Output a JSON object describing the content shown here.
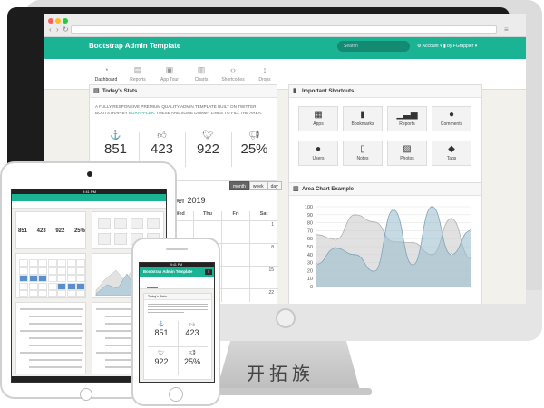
{
  "browser": {
    "title": "Bootstrap Admin Template",
    "search_placeholder": "Search",
    "account_label": "Account",
    "user_label": "by FGrappler"
  },
  "menu": [
    {
      "label": "Dashboard",
      "icon": "dashboard-icon",
      "active": true
    },
    {
      "label": "Reports",
      "icon": "reports-icon",
      "active": false
    },
    {
      "label": "App Tour",
      "icon": "tour-icon",
      "active": false
    },
    {
      "label": "Charts",
      "icon": "charts-icon",
      "active": false
    },
    {
      "label": "Shortcodes",
      "icon": "code-icon",
      "active": false
    },
    {
      "label": "Drops",
      "icon": "drops-icon",
      "active": false
    }
  ],
  "stats": {
    "title": "Today's Stats",
    "description_prefix": "A fully responsive premium quality admin template built on Twitter Bootstrap by",
    "description_link": "EGrappler",
    "description_suffix": ". These are some dummy lines to fill the area.",
    "items": [
      {
        "icon": "anchor-icon",
        "value": "851"
      },
      {
        "icon": "thumbs-up-icon",
        "value": "423"
      },
      {
        "icon": "twitter-icon",
        "value": "922"
      },
      {
        "icon": "bullhorn-icon",
        "value": "25%"
      }
    ]
  },
  "shortcuts": {
    "title": "Important Shortcuts",
    "items": [
      {
        "label": "Apps",
        "icon": "apps-icon"
      },
      {
        "label": "Bookmarks",
        "icon": "bookmark-icon"
      },
      {
        "label": "Reports",
        "icon": "signal-icon"
      },
      {
        "label": "Comments",
        "icon": "comment-icon"
      },
      {
        "label": "Users",
        "icon": "user-icon"
      },
      {
        "label": "Notes",
        "icon": "file-icon"
      },
      {
        "label": "Photos",
        "icon": "picture-icon"
      },
      {
        "label": "Tags",
        "icon": "tag-icon"
      }
    ]
  },
  "calendar": {
    "month_title": "ber 2019",
    "buttons": [
      "month",
      "week",
      "day"
    ],
    "headers": [
      "Wed",
      "Thu",
      "Fri",
      "Sat"
    ],
    "row1": [
      "",
      "",
      "",
      "1"
    ],
    "row2": [
      "",
      "",
      "",
      "8"
    ],
    "row3": [
      "",
      "",
      "",
      "15"
    ],
    "row4": [
      "",
      "",
      "",
      "22"
    ]
  },
  "chart": {
    "title": "Area Chart Example"
  },
  "chart_data": {
    "type": "area",
    "title": "Area Chart Example",
    "ylim": [
      0,
      100
    ],
    "yticks": [
      0,
      10,
      20,
      30,
      40,
      50,
      60,
      70,
      80,
      90,
      100
    ],
    "grid": true,
    "series": [
      {
        "values": [
          65,
          59,
          90,
          81,
          56,
          55,
          40,
          85,
          35
        ]
      },
      {
        "values": [
          28,
          48,
          40,
          19,
          96,
          27,
          100,
          40,
          70
        ]
      }
    ]
  },
  "tablet": {
    "status_time": "9:41 PM",
    "stats": [
      "851",
      "423",
      "922",
      "25%"
    ]
  },
  "phone": {
    "status_time": "9:41 PM",
    "title": "Bootstrap Admin Template",
    "section_title": "Today's Stats",
    "stats": [
      "851",
      "423",
      "922",
      "25%"
    ]
  },
  "watermark": "开拓族",
  "colors": {
    "accent": "#1ab394",
    "active_underline": "#d9534f",
    "area_light": "#dcdcdc",
    "area_blue": "#97bbcd"
  }
}
